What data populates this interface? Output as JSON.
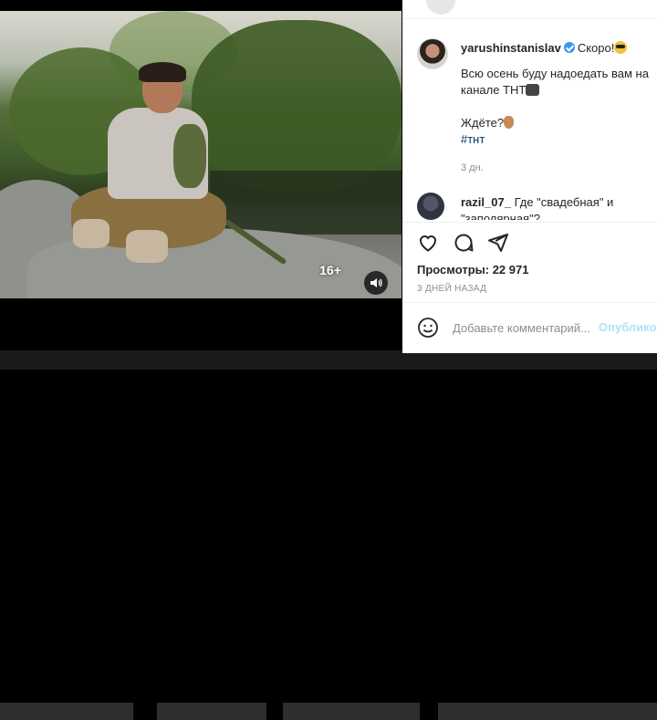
{
  "video": {
    "age_rating": "16+",
    "sound_icon": "speaker-icon"
  },
  "post": {
    "author": "yarushinstanislav",
    "verified": true,
    "caption_first": "Скоро!",
    "caption_lines": [
      "Всю осень буду надоедать вам на",
      "канале ТНТ"
    ],
    "question": "Ждёте?",
    "hashtag": "#тнт",
    "time_ago": "3 дн."
  },
  "comment": {
    "user": "razil_07_",
    "text": "Где \"свадебная\" и \"заполярная\"?"
  },
  "actions": {
    "like_icon": "heart-icon",
    "comment_icon": "comment-icon",
    "share_icon": "share-icon"
  },
  "stats": {
    "views_label": "Просмотры: 22 971",
    "posted_label": "3 ДНЕЙ НАЗАД"
  },
  "add_comment": {
    "placeholder": "Добавьте комментарий...",
    "publish_label": "Опубликовать"
  }
}
